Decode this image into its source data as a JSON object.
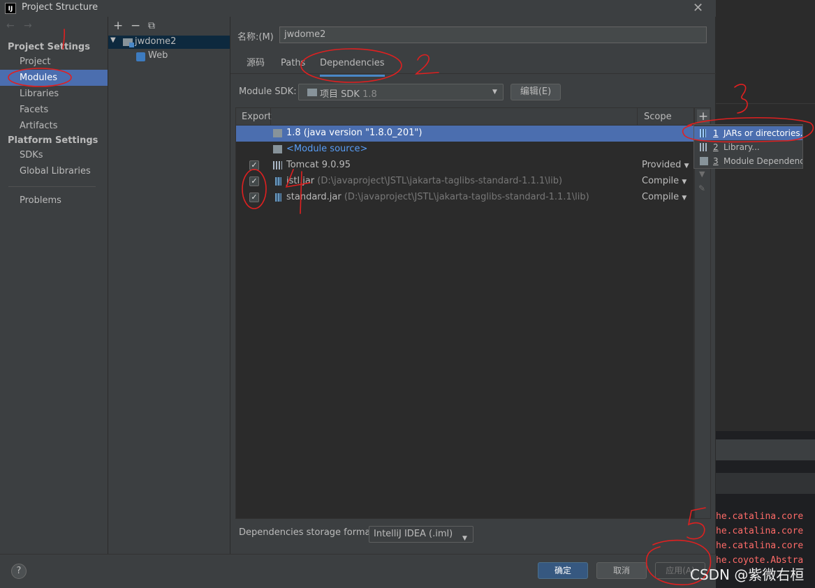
{
  "window": {
    "title": "Project Structure",
    "app_icon": "IJ"
  },
  "nav": {
    "back": "←",
    "forward": "→",
    "project_settings_title": "Project Settings",
    "project_settings_items": [
      "Project",
      "Modules",
      "Libraries",
      "Facets",
      "Artifacts"
    ],
    "platform_settings_title": "Platform Settings",
    "platform_settings_items": [
      "SDKs",
      "Global Libraries"
    ],
    "problems": "Problems",
    "selected": "Modules"
  },
  "tree": {
    "toolbar": {
      "add": "+",
      "remove": "−",
      "copy": "⧉"
    },
    "module": "jwdome2",
    "facet": "Web"
  },
  "module_form": {
    "name_label": "名称:(M)",
    "name_value": "jwdome2",
    "tabs": [
      "源码",
      "Paths",
      "Dependencies"
    ],
    "active_tab": "Dependencies",
    "sdk_label": "Module SDK:",
    "sdk_value": "项目 SDK",
    "sdk_version": "1.8",
    "edit_button": "编辑(E)"
  },
  "dependencies": {
    "columns": [
      "Export",
      "Scope"
    ],
    "rows": [
      {
        "name": "1.8 (java version \"1.8.0_201\")",
        "path": "",
        "scope": "",
        "checked": false,
        "selected": true,
        "icon": "folder-icon"
      },
      {
        "name": "<Module source>",
        "path": "",
        "scope": "",
        "checked": false,
        "selected": false,
        "icon": "module-source-icon"
      },
      {
        "name": "Tomcat 9.0.95",
        "path": "",
        "scope": "Provided",
        "checked": true,
        "selected": false,
        "icon": "library-icon"
      },
      {
        "name": "jstl.jar",
        "path": "(D:\\javaproject\\JSTL\\jakarta-taglibs-standard-1.1.1\\lib)",
        "scope": "Compile",
        "checked": true,
        "selected": false,
        "icon": "jar-icon"
      },
      {
        "name": "standard.jar",
        "path": "(D:\\javaproject\\JSTL\\jakarta-taglibs-standard-1.1.1\\lib)",
        "scope": "Compile",
        "checked": true,
        "selected": false,
        "icon": "jar-icon"
      }
    ],
    "add_button": "+",
    "storage_label": "Dependencies storage format:",
    "storage_value": "IntelliJ IDEA (.iml)"
  },
  "add_menu": {
    "items": [
      {
        "num": "1",
        "label": "JARs or directories...",
        "icon": "jar-icon"
      },
      {
        "num": "2",
        "label": "Library...",
        "icon": "library-icon"
      },
      {
        "num": "3",
        "label": "Module Dependency...",
        "icon": "module-icon"
      }
    ]
  },
  "footer": {
    "help": "?",
    "ok": "确定",
    "cancel": "取消",
    "apply": "应用(A)"
  },
  "background_log": [
    "he.catalina.core",
    "he.catalina.core",
    "he.catalina.core",
    "he.coyote.Abstra"
  ],
  "watermark": "CSDN @紫微右桓",
  "annotation_marks": [
    "1",
    "2",
    "3",
    "4",
    "5"
  ],
  "colors": {
    "selection": "#4b6eaf",
    "panel": "#3c3f41",
    "annotation": "#e02020",
    "link": "#589df6"
  }
}
